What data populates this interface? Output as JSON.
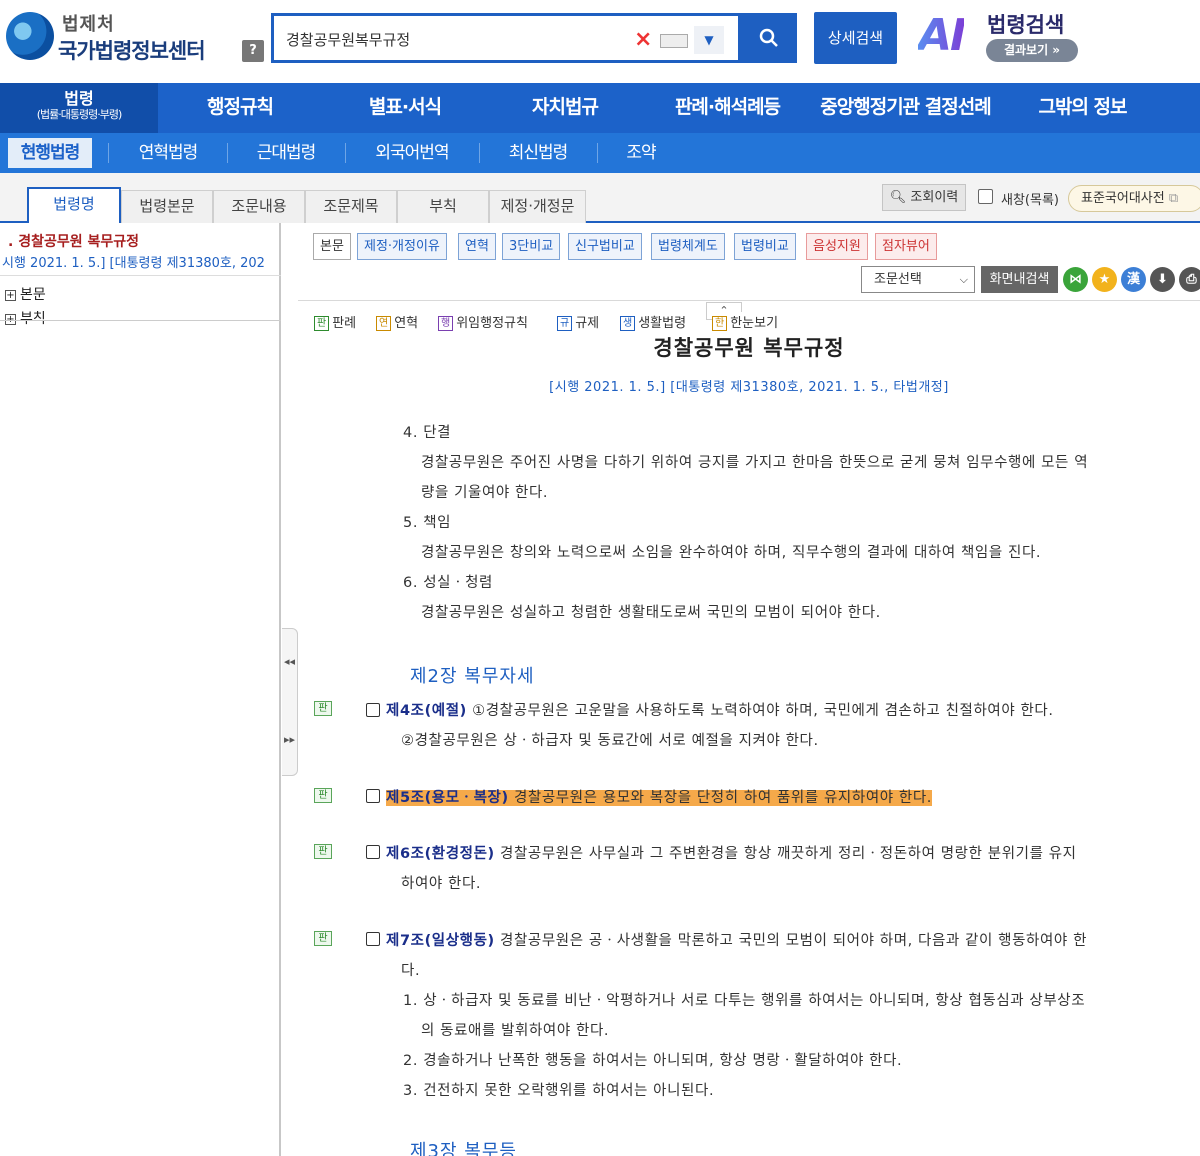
{
  "header": {
    "org": "법제처",
    "site_name": "국가법령정보센터",
    "help_label": "?",
    "search": {
      "value": "경찰공무원복무규정",
      "placeholder": ""
    },
    "advanced_search_label": "상세검색",
    "ai_logo": "AI",
    "ai_title": "법령검색",
    "ai_result_label": "결과보기 »"
  },
  "main_nav": {
    "law_label": "법령",
    "law_sub": "(법률·대통령령·부령)",
    "items": [
      "행정규칙",
      "별표·서식",
      "자치법규",
      "판례·해석례등",
      "중앙행정기관 결정선례",
      "그밖의 정보"
    ]
  },
  "sub_nav": {
    "items": [
      "현행법령",
      "연혁법령",
      "근대법령",
      "외국어번역",
      "최신법령",
      "조약"
    ]
  },
  "tabs": [
    "법령명",
    "법령본문",
    "조문내용",
    "조문제목",
    "부칙",
    "제정·개정문"
  ],
  "tab_tools": {
    "history": "조회이력",
    "new_window": "새창(목록)",
    "dictionary": "표준국어대사전"
  },
  "left_panel": {
    "title": ". 경찰공무원 복무규정",
    "subtitle": "시행 2021. 1. 5.] [대통령령 제31380호, 202",
    "tree": [
      "본문",
      "부칙"
    ],
    "tree_marker": "⊞"
  },
  "toolbar": {
    "buttons": [
      "본문",
      "제정·개정이유",
      "연혁",
      "3단비교",
      "신구법비교",
      "법령체계도",
      "법령비교"
    ],
    "red_buttons": [
      "음성지원",
      "점자뷰어"
    ],
    "select_label": "조문선택",
    "screen_search": "화면내검색",
    "icons": {
      "share": "⋈",
      "star": "★",
      "hanja": "漢",
      "download": "⬇",
      "print": "⎙"
    }
  },
  "legend": [
    {
      "mark": "판",
      "label": "판례",
      "color": "#2e8b2e"
    },
    {
      "mark": "연",
      "label": "연혁",
      "color": "#c98a00"
    },
    {
      "mark": "행",
      "label": "위임행정규칙",
      "color": "#7a3fb0"
    },
    {
      "mark": "규",
      "label": "규제",
      "color": "#1e5fc1"
    },
    {
      "mark": "생",
      "label": "생활법령",
      "color": "#1e5fc1"
    },
    {
      "mark": "한",
      "label": "한눈보기",
      "color": "#c98a00"
    }
  ],
  "document": {
    "title": "경찰공무원 복무규정",
    "subtitle": "[시행 2021. 1. 5.] [대통령령 제31380호, 2021. 1. 5., 타법개정]",
    "intro_lines": [
      "4. 단결",
      "경찰공무원은 주어진 사명을 다하기 위하여 긍지를 가지고 한마음 한뜻으로 굳게 뭉쳐 임무수행에 모든 역",
      "량을 기울여야 한다.",
      "5. 책임",
      "경찰공무원은 창의와 노력으로써 소임을 완수하여야 하며, 직무수행의 결과에 대하여 책임을 진다.",
      "6. 성실ㆍ청렴",
      "경찰공무원은 성실하고 청렴한 생활태도로써 국민의 모범이 되어야 한다."
    ],
    "chapter2": "제2장 복무자세",
    "pan_mark": "판",
    "art4": {
      "title": "제4조(예절)",
      "text": " ①경찰공무원은 고운말을 사용하도록 노력하여야 하며, 국민에게 겸손하고 친절하여야 한다.",
      "line2": "②경찰공무원은 상ㆍ하급자 및 동료간에 서로 예절을 지켜야 한다."
    },
    "art5": {
      "title": "제5조(용모ㆍ복장)",
      "text": " 경찰공무원은 용모와 복장을 단정히 하여 품위를 유지하여야 한다."
    },
    "art6": {
      "title": "제6조(환경정돈)",
      "text": " 경찰공무원은 사무실과 그 주변환경을 항상 깨끗하게 정리ㆍ정돈하여 명랑한 분위기를 유지",
      "line2": "하여야 한다."
    },
    "art7": {
      "title": "제7조(일상행동)",
      "text": " 경찰공무원은 공ㆍ사생활을 막론하고 국민의 모범이 되어야 하며, 다음과 같이 행동하여야 한",
      "line2": "다.",
      "items": [
        "1. 상ㆍ하급자 및 동료를 비난ㆍ악평하거나 서로 다투는 행위를 하여서는 아니되며, 항상 협동심과 상부상조",
        "의 동료애를 발휘하여야 한다.",
        "2. 경솔하거나 난폭한 행동을 하여서는 아니되며, 항상 명랑ㆍ활달하여야 한다.",
        "3. 건전하지 못한 오락행위를 하여서는 아니된다."
      ]
    },
    "chapter3": "제3장 복무등"
  }
}
